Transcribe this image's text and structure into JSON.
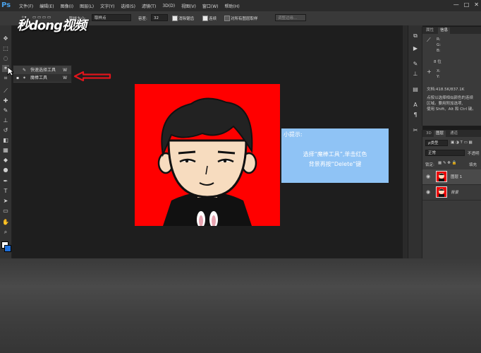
{
  "app": {
    "logo": "Ps",
    "watermark": "秒dong视频"
  },
  "menu": [
    "文件(F)",
    "编辑(E)",
    "图像(I)",
    "图层(L)",
    "文字(Y)",
    "选择(S)",
    "滤镜(T)",
    "3D(D)",
    "视图(V)",
    "窗口(W)",
    "帮助(H)"
  ],
  "window_controls": [
    "—",
    "□",
    "✕"
  ],
  "options": {
    "sample_size_label": "取样大小:",
    "sample_size_value": "取样点",
    "tolerance_label": "容差:",
    "tolerance_value": "32",
    "antialias_label": "消除锯齿",
    "contiguous_label": "连续",
    "all_layers_label": "对所有图层取样",
    "refine_edge": "调整边缘..."
  },
  "flyout": {
    "items": [
      {
        "label": "快速选择工具",
        "key": "W"
      },
      {
        "label": "魔棒工具",
        "key": "W"
      }
    ]
  },
  "tip": {
    "title": "小提示:",
    "body_line1": "选择“魔棒工具”,单击红色",
    "body_line2": "背景再按“Delete”键"
  },
  "info_panel": {
    "tabs": [
      "属性",
      "信息"
    ],
    "rgb_labels": [
      "R:",
      "G:",
      "B:"
    ],
    "bits": "8 位",
    "xy_labels": [
      "X:",
      "Y:"
    ],
    "doc_size": "文档:418.5K/837.1K",
    "hint_lines": [
      "点按以选择相似颜色的连续",
      "区域。要用附加选项,",
      "使用 Shift、Alt 和 Ctrl 键。"
    ]
  },
  "layers_panel": {
    "tabs": [
      "3D",
      "图层",
      "通道"
    ],
    "kind_filter": "ρ类型",
    "blend_mode": "正常",
    "opacity_label": "不透明",
    "lock_label": "锁定:",
    "fill_label": "填充",
    "layers": [
      {
        "name": "图层 1",
        "selected": true
      },
      {
        "name": "背景",
        "selected": false
      }
    ]
  },
  "colors": {
    "canvas_red": "#ff0000",
    "tip_blue": "#8fc3f5",
    "arrow_red": "#e0141b"
  }
}
